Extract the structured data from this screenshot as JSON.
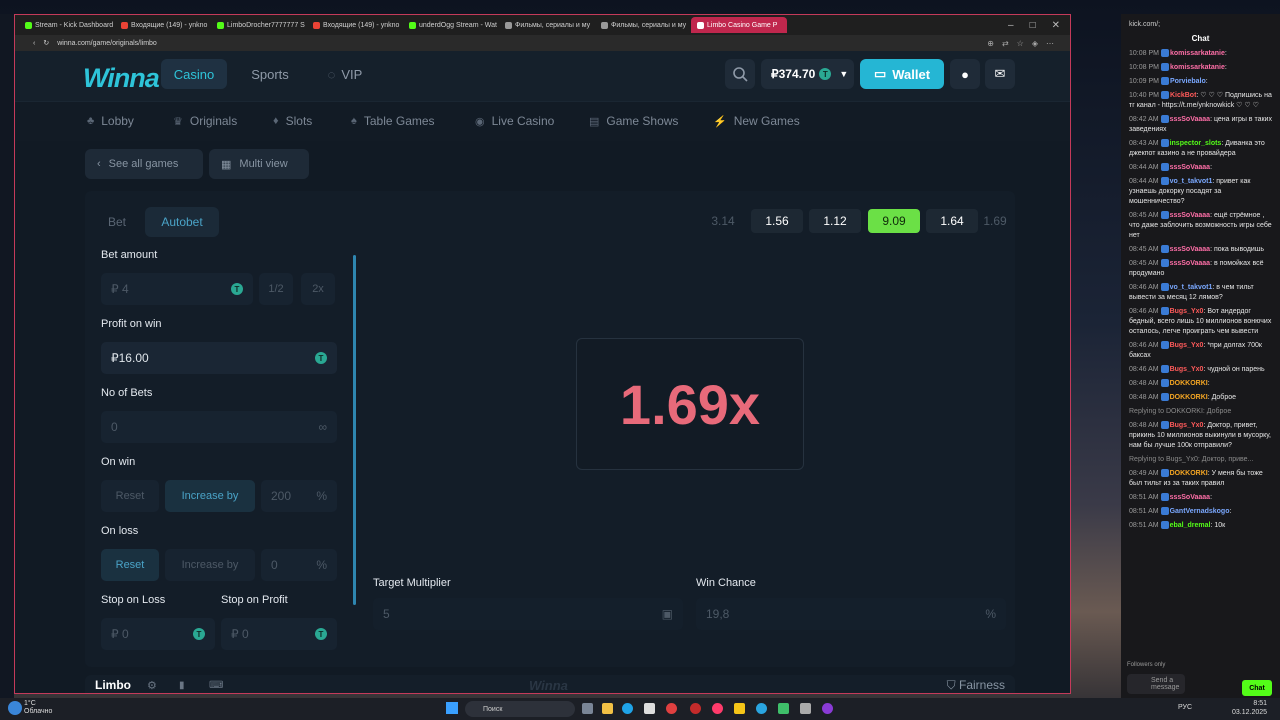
{
  "browser": {
    "tabs": [
      {
        "label": "Stream - Kick Dashboard",
        "color": "#53fc18"
      },
      {
        "label": "Входящие (149) - ynkno",
        "color": "#ea4335"
      },
      {
        "label": "LimboDrocher7777777 S",
        "color": "#53fc18"
      },
      {
        "label": "Входящие (149) - ynkno",
        "color": "#ea4335"
      },
      {
        "label": "underdOgg Stream - Wat",
        "color": "#53fc18"
      },
      {
        "label": "Фильмы, сериалы и му",
        "color": "#999999"
      },
      {
        "label": "Фильмы, сериалы и му",
        "color": "#999999"
      },
      {
        "label": "Limbo Casino Game P",
        "color": "#ffffff",
        "active": true
      }
    ],
    "url": "winna.com/game/originals/limbo"
  },
  "site": {
    "logo": "Winna",
    "nav": {
      "casino": "Casino",
      "sports": "Sports",
      "vip": "VIP"
    },
    "balance": "₽374.70",
    "coin_symbol": "T",
    "wallet_label": "Wallet",
    "categories": [
      "Lobby",
      "Originals",
      "Slots",
      "Table Games",
      "Live Casino",
      "Game Shows",
      "New Games"
    ],
    "see_all": "See all games",
    "multi_view": "Multi view"
  },
  "game": {
    "modes": {
      "bet": "Bet",
      "autobet": "Autobet"
    },
    "bet_amount": {
      "label": "Bet amount",
      "placeholder": "₽ 4",
      "half": "1/2",
      "double": "2x"
    },
    "profit_on_win": {
      "label": "Profit on win",
      "value": "₽16.00"
    },
    "no_of_bets": {
      "label": "No of Bets",
      "value": "0",
      "infinity": "∞"
    },
    "on_win": {
      "label": "On win",
      "reset": "Reset",
      "increase": "Increase by",
      "value": "200",
      "pct": "%"
    },
    "on_loss": {
      "label": "On loss",
      "reset": "Reset",
      "increase": "Increase by",
      "value": "0",
      "pct": "%"
    },
    "stop_loss": {
      "label": "Stop on Loss",
      "value": "₽ 0"
    },
    "stop_profit": {
      "label": "Stop on Profit",
      "value": "₽ 0"
    },
    "history": [
      "3.14",
      "1.56",
      "1.12",
      "9.09",
      "1.64",
      "1.69"
    ],
    "result": "1.69x",
    "target_multiplier": {
      "label": "Target Multiplier",
      "value": "5"
    },
    "win_chance": {
      "label": "Win Chance",
      "value": "19,8",
      "pct": "%"
    },
    "footer_title": "Limbo",
    "footer_logo": "Winna",
    "fairness": "Fairness"
  },
  "chat": {
    "url": "kick.com/;",
    "title": "Chat",
    "messages": [
      {
        "time": "10:08 PM",
        "user": "komissarkatanie",
        "color": "#ff6fa8",
        "text": ":"
      },
      {
        "time": "10:08 PM",
        "user": "komissarkatanie",
        "color": "#ff6fa8",
        "text": ":"
      },
      {
        "time": "10:09 PM",
        "user": "Porviebalo",
        "color": "#7aa8ff",
        "text": ":"
      },
      {
        "time": "10:40 PM",
        "user": "KickBot",
        "color": "#ff5a5a",
        "text": ": ♡ ♡ ♡ Подпишись на тг канал - https://t.me/ynknowkick ♡ ♡ ♡"
      },
      {
        "time": "08:42 AM",
        "user": "sssSoVaaaa",
        "color": "#ff6fa8",
        "text": ": цена игры в таких заведениях"
      },
      {
        "time": "08:43 AM",
        "user": "inspector_slots",
        "color": "#53fc18",
        "text": ": Диванка это джекпот казино а не провайдера"
      },
      {
        "time": "08:44 AM",
        "user": "sssSoVaaaa",
        "color": "#ff6fa8",
        "text": ":"
      },
      {
        "time": "08:44 AM",
        "user": "vo_t_takvot1",
        "color": "#7aa8ff",
        "text": ": привет как узнаешь докорку посадят за мошенничество?"
      },
      {
        "time": "08:45 AM",
        "user": "sssSoVaaaa",
        "color": "#ff6fa8",
        "text": ": ещё стрёмное , что даже заблочить возможность игры себе нет"
      },
      {
        "time": "08:45 AM",
        "user": "sssSoVaaaa",
        "color": "#ff6fa8",
        "text": ": пока выводишь"
      },
      {
        "time": "08:45 AM",
        "user": "sssSoVaaaa",
        "color": "#ff6fa8",
        "text": ": в помойках всё продумано"
      },
      {
        "time": "08:46 AM",
        "user": "vo_t_takvot1",
        "color": "#7aa8ff",
        "text": ": в чем тильт вывести за месяц 12 лямов?"
      },
      {
        "time": "08:46 AM",
        "user": "Bugs_Yx0",
        "color": "#ff5a5a",
        "text": ": Вот андердог бедный, всего лишь 10 миллионов вонючих осталось, легче проиграть чем вывести"
      },
      {
        "time": "08:46 AM",
        "user": "Bugs_Yx0",
        "color": "#ff5a5a",
        "text": ": *при долгах 700к баксах"
      },
      {
        "time": "08:46 AM",
        "user": "Bugs_Yx0",
        "color": "#ff5a5a",
        "text": ": чудной он парень"
      },
      {
        "time": "08:48 AM",
        "user": "DOKKORKI",
        "color": "#f5a623",
        "text": ":"
      },
      {
        "time": "08:48 AM",
        "user": "DOKKORKI",
        "color": "#f5a623",
        "text": ": Доброе"
      },
      {
        "reply": "Replying to DOKKORKI: Доброе"
      },
      {
        "time": "08:48 AM",
        "user": "Bugs_Yx0",
        "color": "#ff5a5a",
        "text": ": Доктор, привет, прикинь 10 миллионов выкинули в мусорку, нам бы лучше 100к отправили?"
      },
      {
        "reply": "Replying to Bugs_Yx0: Доктор, приве..."
      },
      {
        "time": "08:49 AM",
        "user": "DOKKORKI",
        "color": "#f5a623",
        "text": ": У меня бы тоже был тильт из за таких правил"
      },
      {
        "time": "08:51 AM",
        "user": "sssSoVaaaa",
        "color": "#ff6fa8",
        "text": ":"
      },
      {
        "time": "08:51 AM",
        "user": "GantVernadskogo",
        "color": "#7aa8ff",
        "text": ":"
      },
      {
        "time": "08:51 AM",
        "user": "ebal_dremal",
        "color": "#53fc18",
        "text": ": 10к"
      }
    ],
    "followers_only": "Followers only",
    "send_placeholder": "Send a message",
    "send_button": "Chat"
  },
  "taskbar": {
    "search": "Поиск",
    "weather": "1°C",
    "weather_desc": "Облачно",
    "lang": "РУС",
    "time": "8:51",
    "date": "03.12.2025"
  }
}
